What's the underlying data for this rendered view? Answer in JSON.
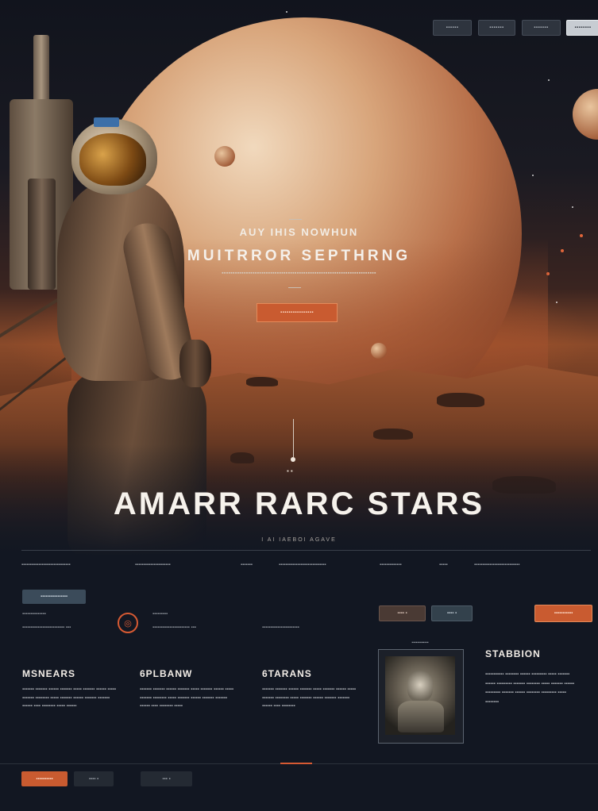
{
  "nav": {
    "buttons": [
      "▪▪▪▪▪▪",
      "▪▪▪▪▪▪▪",
      "▪▪▪▪▪▪▪",
      "▪▪▪▪▪▪▪▪"
    ]
  },
  "hero": {
    "pretitle": "AUY IHIS NOWHUN",
    "title": "MUITRROR SEPTHRNG",
    "subtitle": "▪▪▪▪▪▪▪▪▪▪▪▪▪▪▪▪▪▪▪▪▪▪▪▪▪▪▪▪▪▪▪▪▪▪▪▪▪▪▪▪▪▪▪▪▪▪▪▪▪▪▪▪▪▪▪▪▪▪▪▪▪▪▪▪▪▪▪▪▪▪",
    "cta": "▪▪▪▪▪▪▪▪▪▪▪▪▪▪▪▪",
    "scroll_marks": "▪▪"
  },
  "section": {
    "title": "AMARR RARC STARS",
    "caption": "I AI IAEBOI AGAVE",
    "meta": [
      "▪▪▪▪▪▪▪▪▪▪▪▪▪▪▪▪▪▪▪▪▪▪▪▪▪▪▪▪▪",
      "▪▪▪▪▪▪▪▪▪▪▪▪▪▪▪▪▪▪▪▪▪",
      "▪▪▪▪▪▪▪",
      "▪▪▪▪▪▪▪▪▪▪▪▪▪▪▪▪▪▪▪▪▪▪▪▪▪▪▪▪",
      "▪▪▪▪▪▪▪▪▪▪▪▪▪",
      "▪▪▪▪▪",
      "▪▪▪▪▪▪▪▪▪▪▪▪▪▪▪▪▪▪▪▪▪▪▪▪▪▪▪"
    ]
  },
  "toolbar": {
    "left_pill": "▪▪▪▪▪▪▪▪▪▪▪▪▪▪▪▪",
    "pill_a": "▪▪▪▪ ▪",
    "pill_b": "▪▪▪▪ ▪",
    "cta_right": "▪▪▪▪▪▪▪▪▪▪▪"
  },
  "features": {
    "lead_labels": [
      "▪▪▪▪▪▪▪▪▪▪▪▪▪▪",
      "▪▪▪▪▪▪▪▪▪",
      "▪▪▪▪▪▪▪▪"
    ],
    "lead_values": [
      "▪▪▪▪▪▪▪▪▪▪▪▪▪▪▪▪▪▪▪▪▪▪▪▪▪ ▪▪▪",
      "▪▪▪▪▪▪▪▪▪▪▪▪▪▪▪▪▪▪▪▪▪▪ ▪▪▪",
      "▪▪▪▪▪▪▪▪▪▪▪▪▪▪▪▪▪▪▪▪▪▪"
    ]
  },
  "columns": [
    {
      "heading": "MSNEARS",
      "body": "▪▪▪▪▪▪▪ ▪▪▪▪▪▪▪ ▪▪▪▪▪▪ ▪▪▪▪▪▪▪ ▪▪▪▪▪ ▪▪▪▪▪▪▪ ▪▪▪▪▪▪ ▪▪▪▪▪ ▪▪▪▪▪▪▪ ▪▪▪▪▪▪▪▪ ▪▪▪▪▪ ▪▪▪▪▪▪▪ ▪▪▪▪▪▪ ▪▪▪▪▪▪▪ ▪▪▪▪▪▪▪ ▪▪▪▪▪▪ ▪▪▪▪ ▪▪▪▪▪▪▪▪ ▪▪▪▪▪ ▪▪▪▪▪▪"
    },
    {
      "heading": "6PLBANW",
      "body": "▪▪▪▪▪▪▪ ▪▪▪▪▪▪▪ ▪▪▪▪▪▪ ▪▪▪▪▪▪▪ ▪▪▪▪▪ ▪▪▪▪▪▪▪ ▪▪▪▪▪▪ ▪▪▪▪▪ ▪▪▪▪▪▪▪ ▪▪▪▪▪▪▪▪ ▪▪▪▪▪ ▪▪▪▪▪▪▪ ▪▪▪▪▪▪ ▪▪▪▪▪▪▪ ▪▪▪▪▪▪▪ ▪▪▪▪▪▪ ▪▪▪▪ ▪▪▪▪▪▪▪▪ ▪▪▪▪▪"
    },
    {
      "heading": "6TARANS",
      "body": "▪▪▪▪▪▪▪ ▪▪▪▪▪▪▪ ▪▪▪▪▪▪ ▪▪▪▪▪▪▪ ▪▪▪▪▪ ▪▪▪▪▪▪▪ ▪▪▪▪▪▪ ▪▪▪▪▪ ▪▪▪▪▪▪▪ ▪▪▪▪▪▪▪▪ ▪▪▪▪▪ ▪▪▪▪▪▪▪ ▪▪▪▪▪▪ ▪▪▪▪▪▪▪ ▪▪▪▪▪▪▪ ▪▪▪▪▪▪ ▪▪▪▪ ▪▪▪▪▪▪▪▪"
    }
  ],
  "gallery": {
    "caption": "▪▪▪▪▪▪▪▪▪▪▪▪"
  },
  "sidebar": {
    "heading": "STABBION",
    "body": "▪▪▪▪▪▪▪▪▪▪▪ ▪▪▪▪▪▪▪▪ ▪▪▪▪▪▪ ▪▪▪▪▪▪▪▪▪ ▪▪▪▪▪ ▪▪▪▪▪▪▪ ▪▪▪▪▪▪ ▪▪▪▪▪▪▪▪▪ ▪▪▪▪▪▪▪ ▪▪▪▪▪▪▪▪ ▪▪▪▪▪ ▪▪▪▪▪▪▪ ▪▪▪▪▪▪ ▪▪▪▪▪▪▪▪▪ ▪▪▪▪▪▪▪ ▪▪▪▪▪▪ ▪▪▪▪▪▪▪▪ ▪▪▪▪▪▪▪▪▪ ▪▪▪▪▪ ▪▪▪▪▪▪▪▪"
  },
  "footer": {
    "primary": "▪▪▪▪▪▪▪▪▪▪",
    "secondary": "▪▪▪▪ ▪",
    "tertiary": "▪▪▪ ▪"
  },
  "colors": {
    "accent": "#c95b30",
    "background": "#121722"
  }
}
